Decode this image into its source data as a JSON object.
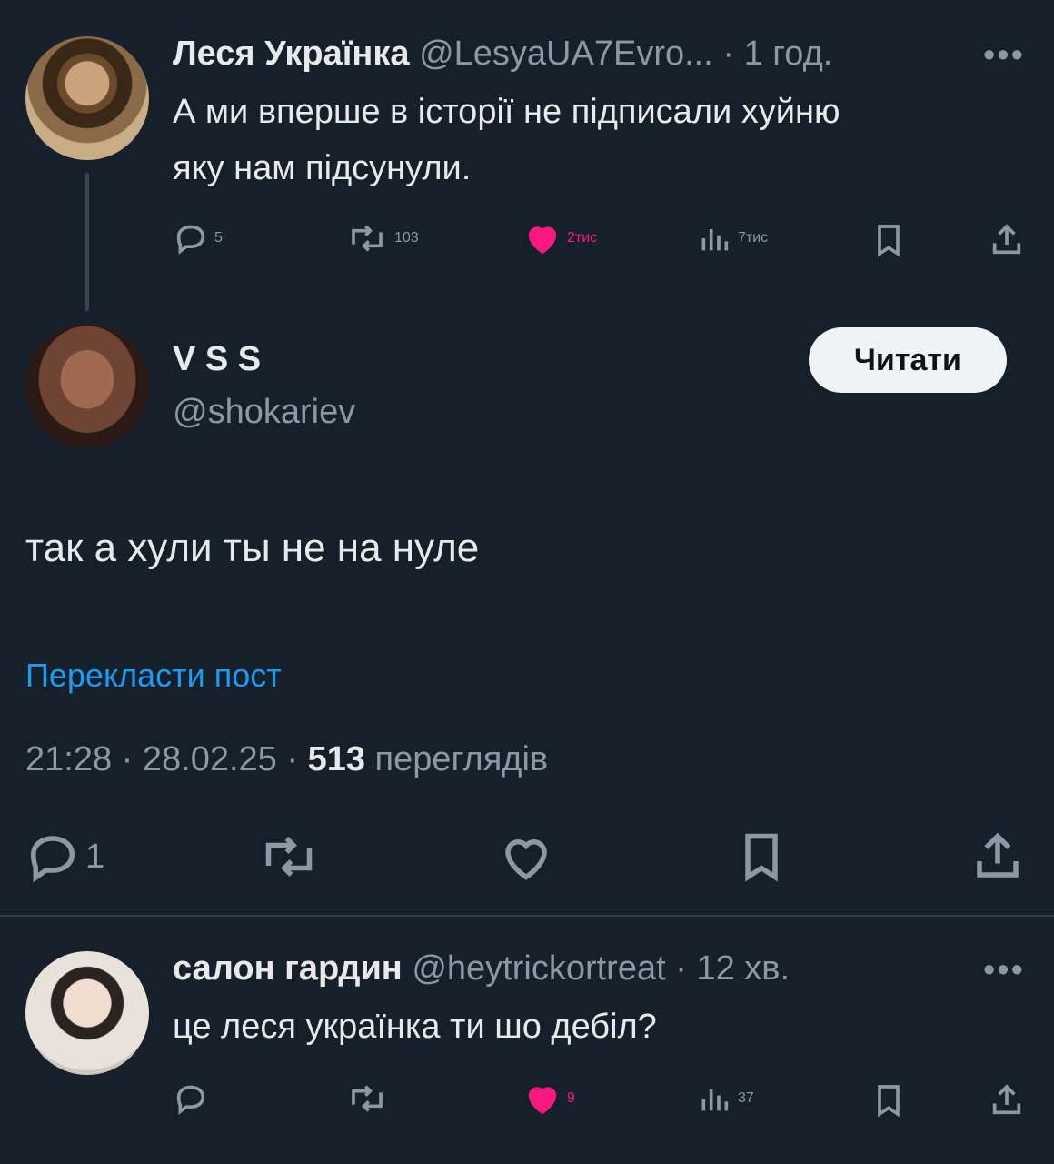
{
  "tweet1": {
    "name": "Леся Українка",
    "handle": "@LesyaUA7Evro...",
    "sep": "·",
    "time": "1 год.",
    "more": "•••",
    "text_line1": "А ми вперше в історії не підписали хуйню",
    "text_line2": "яку нам підсунули.",
    "replies": "5",
    "reposts": "103",
    "likes": "2тис",
    "views": "7тис"
  },
  "main_tweet": {
    "name": "V S S",
    "handle": "@shokariev",
    "follow_label": "Читати",
    "text": "так а хули ты не на нуле",
    "translate_label": "Перекласти пост",
    "time": "21:28",
    "date": "28.02.25",
    "views_count": "513",
    "views_label": "переглядів",
    "sep": "·",
    "replies": "1"
  },
  "reply": {
    "name": "салон гардин",
    "handle": "@heytrickortreat",
    "sep": "·",
    "time": "12 хв.",
    "more": "•••",
    "text": "це леся українка ти шо дебіл?",
    "likes": "9",
    "views": "37"
  },
  "colors": {
    "background": "#15202b",
    "accent_blue": "#1d9bf0",
    "like_pink": "#f91880",
    "muted": "#8b98a5"
  },
  "icons": [
    "reply-icon",
    "repost-icon",
    "heart-icon",
    "views-icon",
    "bookmark-icon",
    "share-icon",
    "more-icon"
  ]
}
